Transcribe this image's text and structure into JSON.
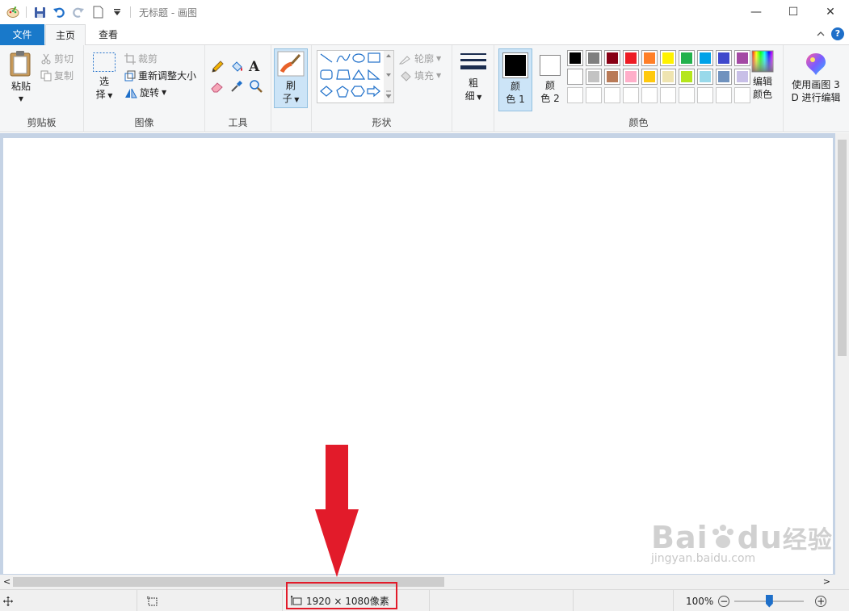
{
  "window": {
    "title": "无标题 - 画图",
    "minimize": "—",
    "maximize": "☐",
    "close": "✕"
  },
  "tabs": {
    "file": "文件",
    "home": "主页",
    "view": "查看",
    "collapse": "^",
    "help": "?"
  },
  "clipboard": {
    "paste": "粘贴",
    "cut": "剪切",
    "copy": "复制",
    "label": "剪贴板"
  },
  "image": {
    "select_1": "选",
    "select_2": "择",
    "crop": "裁剪",
    "resize": "重新调整大小",
    "rotate": "旋转",
    "label": "图像"
  },
  "tools": {
    "text_glyph": "A",
    "label": "工具"
  },
  "brushes": {
    "line1": "刷",
    "line2": "子"
  },
  "shapes": {
    "outline": "轮廓",
    "fill": "填充",
    "label": "形状"
  },
  "size": {
    "line1": "粗",
    "line2": "细"
  },
  "colors": {
    "color1_line1": "颜",
    "color1_line2": "色 1",
    "color2_line1": "颜",
    "color2_line2": "色 2",
    "edit_line1": "编辑",
    "edit_line2": "颜色",
    "label": "颜色",
    "color1_value": "#000000",
    "color2_value": "#ffffff",
    "palette": [
      "#000000",
      "#7f7f7f",
      "#880015",
      "#ed1c24",
      "#ff7f27",
      "#fff200",
      "#22b14c",
      "#00a2e8",
      "#3f48cc",
      "#a349a4",
      "#ffffff",
      "#c3c3c3",
      "#b97a57",
      "#ffaec9",
      "#ffc90e",
      "#efe4b0",
      "#b5e61d",
      "#99d9ea",
      "#7092be",
      "#c8bfe7",
      "",
      "",
      "",
      "",
      "",
      "",
      "",
      "",
      "",
      ""
    ]
  },
  "paint3d": {
    "line1": "使用画图 3",
    "line2": "D 进行编辑"
  },
  "status": {
    "dimensions": "1920 × 1080像素",
    "zoom": "100%",
    "zoom_fraction": 0.5
  },
  "watermark": {
    "brand": "Bai",
    "brand2": "du",
    "cn": "经验",
    "url": "jingyan.baidu.com"
  }
}
